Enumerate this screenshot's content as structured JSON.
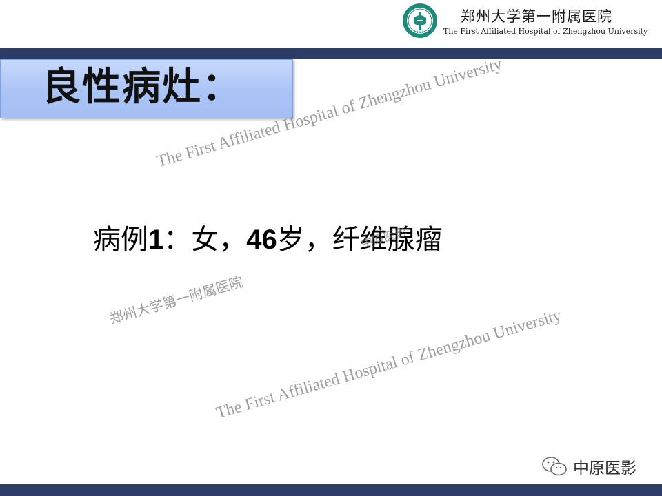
{
  "header": {
    "hospital_name_cn": "郑州大学第一附属医院",
    "hospital_name_en": "The First Affiliated Hospital of Zhengzhou University",
    "logo_icon": "hospital-seal-logo"
  },
  "slide": {
    "title": "良性病灶：",
    "case_prefix": "病例",
    "case_number": "1",
    "case_sep1": "：女，",
    "case_age": "46",
    "case_age_unit": "岁，",
    "case_diagnosis": "纤维腺瘤"
  },
  "watermarks": {
    "en_1": "The First Affiliated Hospital of Zhengzhou University",
    "en_2": "The First Affiliated Hospital of Zhengzhou University",
    "cn_1": "郑州大学第一附属医院",
    "cn_2": "中原医影"
  },
  "footer": {
    "badge_text": "中原医影",
    "badge_icon": "wechat-icon"
  },
  "colors": {
    "bar": "#2b3c66",
    "title_box": "#a9c3f6",
    "logo_teal": "#1e8a7a"
  }
}
